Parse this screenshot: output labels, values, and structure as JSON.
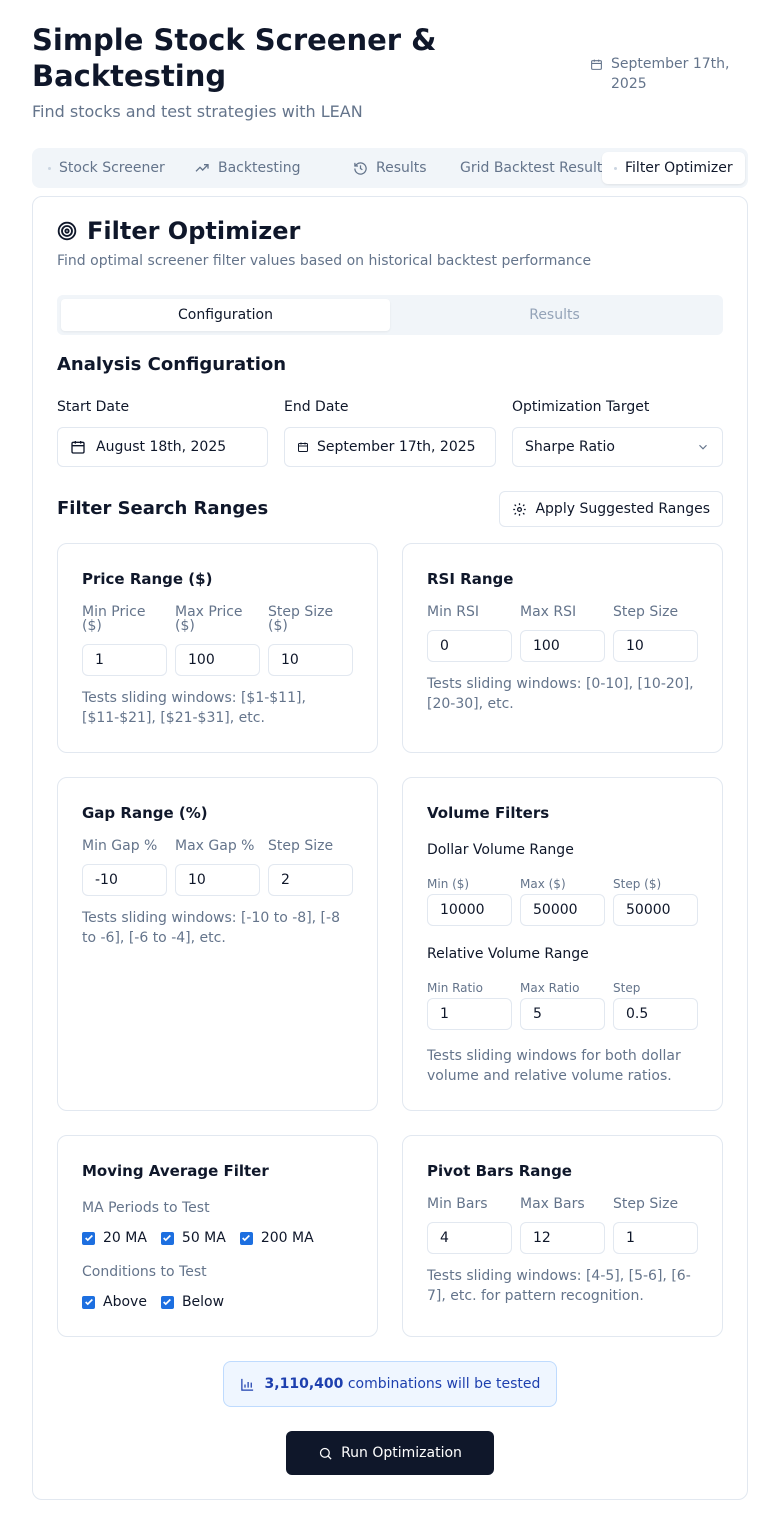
{
  "app": {
    "title": "Simple Stock Screener & Backtesting",
    "subtitle": "Find stocks and test strategies with LEAN",
    "date": "September 17th, 2025"
  },
  "tabs": [
    {
      "label": "Stock Screener",
      "icon": "dot"
    },
    {
      "label": "Backtesting",
      "icon": "trending-up-icon"
    },
    {
      "label": "Results",
      "icon": "history-icon"
    },
    {
      "label": "Grid Backtest Results",
      "icon": "none"
    },
    {
      "label": "Filter Optimizer",
      "icon": "dot",
      "active": true
    }
  ],
  "optimizer": {
    "title": "Filter Optimizer",
    "description": "Find optimal screener filter values based on historical backtest performance",
    "subtabs": [
      "Configuration",
      "Results"
    ],
    "analysis": {
      "heading": "Analysis Configuration",
      "start_label": "Start Date",
      "start_value": "August 18th, 2025",
      "end_label": "End Date",
      "end_value": "September 17th, 2025",
      "target_label": "Optimization Target",
      "target_value": "Sharpe Ratio"
    },
    "ranges_heading": "Filter Search Ranges",
    "apply_button": "Apply Suggested Ranges",
    "price": {
      "title": "Price Range ($)",
      "labels": [
        "Min Price ($)",
        "Max Price ($)",
        "Step Size ($)"
      ],
      "values": [
        "1",
        "100",
        "10"
      ],
      "hint": "Tests sliding windows: [$1-$11], [$11-$21], [$21-$31], etc."
    },
    "rsi": {
      "title": "RSI Range",
      "labels": [
        "Min RSI",
        "Max RSI",
        "Step Size"
      ],
      "values": [
        "0",
        "100",
        "10"
      ],
      "hint": "Tests sliding windows: [0-10], [10-20], [20-30], etc."
    },
    "gap": {
      "title": "Gap Range (%)",
      "labels": [
        "Min Gap %",
        "Max Gap %",
        "Step Size"
      ],
      "values": [
        "-10",
        "10",
        "2"
      ],
      "hint": "Tests sliding windows: [-10 to -8], [-8 to -6], [-6 to -4], etc."
    },
    "volume": {
      "title": "Volume Filters",
      "dollar_label": "Dollar Volume Range",
      "dollar_labels": [
        "Min ($)",
        "Max ($)",
        "Step ($)"
      ],
      "dollar_values": [
        "10000",
        "50000",
        "50000"
      ],
      "relative_label": "Relative Volume Range",
      "relative_labels": [
        "Min Ratio",
        "Max Ratio",
        "Step"
      ],
      "relative_values": [
        "1",
        "5",
        "0.5"
      ],
      "hint": "Tests sliding windows for both dollar volume and relative volume ratios."
    },
    "ma": {
      "title": "Moving Average Filter",
      "periods_label": "MA Periods to Test",
      "periods": [
        "20 MA",
        "50 MA",
        "200 MA"
      ],
      "conditions_label": "Conditions to Test",
      "conditions": [
        "Above",
        "Below"
      ]
    },
    "pivot": {
      "title": "Pivot Bars Range",
      "labels": [
        "Min Bars",
        "Max Bars",
        "Step Size"
      ],
      "values": [
        "4",
        "12",
        "1"
      ],
      "hint": "Tests sliding windows: [4-5], [5-6], [6-7], etc. for pattern recognition."
    },
    "combinations_count": "3,110,400",
    "combinations_text": "combinations will be tested",
    "run_button": "Run Optimization"
  },
  "colors": {
    "primary": "#0f172a",
    "accent": "#1d6fe0",
    "muted": "#64748b",
    "info_bg": "#eff6ff"
  }
}
